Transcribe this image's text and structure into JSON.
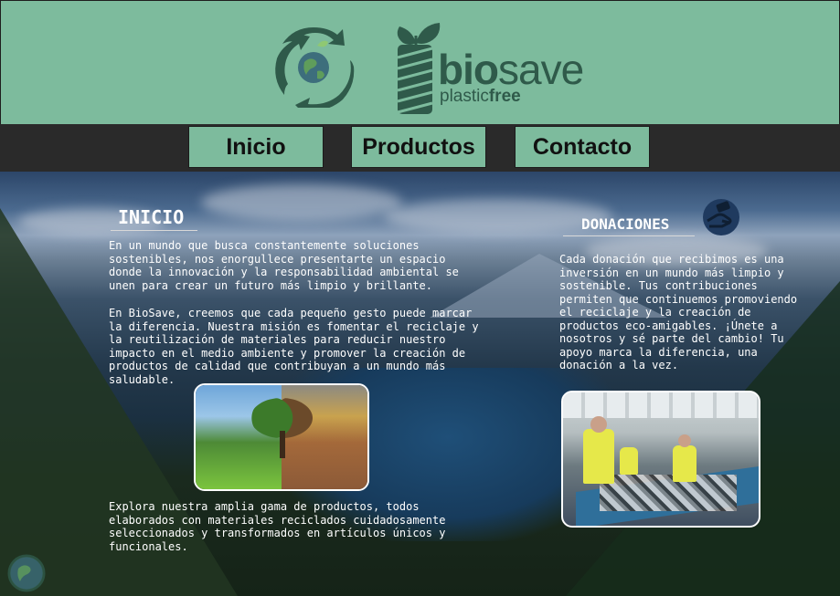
{
  "brand": {
    "name_bio": "bio",
    "name_save": "save",
    "tagline_plastic": "plastic",
    "tagline_free": "free",
    "color": "#2f5a4a"
  },
  "nav": {
    "items": [
      {
        "label": "Inicio"
      },
      {
        "label": "Productos"
      },
      {
        "label": "Contacto"
      }
    ]
  },
  "inicio": {
    "title": "INICIO",
    "p1": "En un mundo que busca constantemente soluciones\nsostenibles, nos enorgullece presentarte un espacio\ndonde la innovación y la responsabilidad ambiental se\nunen para crear un futuro más limpio y brillante.",
    "p2": "En BioSave, creemos que cada pequeño gesto puede marcar\nla diferencia. Nuestra misión es fomentar el reciclaje y\nla reutilización de materiales para reducir nuestro\nimpacto en el medio ambiente y promover la creación de\nproductos de calidad que contribuyan a un mundo más\nsaludable.",
    "p3": "Explora nuestra amplia gama de productos, todos\nelaborados con materiales reciclados cuidadosamente\nseleccionados y transformados en artículos únicos y\nfuncionales."
  },
  "donaciones": {
    "title": "DONACIONES",
    "p1": "Cada donación que recibimos es una\ninversión en un mundo más limpio y\nsostenible. Tus contribuciones\npermiten que continuemos promoviendo\nel reciclaje y la creación de\nproductos eco-amigables. ¡Únete a\nnosotros y sé parte del cambio! Tu\napoyo marca la diferencia, una\ndonación a la vez."
  },
  "icons": {
    "recycle_globe": "recycle-globe-icon",
    "bottle_leaf": "bottle-leaf-icon",
    "donate_hand": "donate-hand-icon"
  },
  "colors": {
    "header_bg": "#7dbb9d",
    "nav_bg": "#2a2a2a",
    "text": "#ffffff"
  }
}
